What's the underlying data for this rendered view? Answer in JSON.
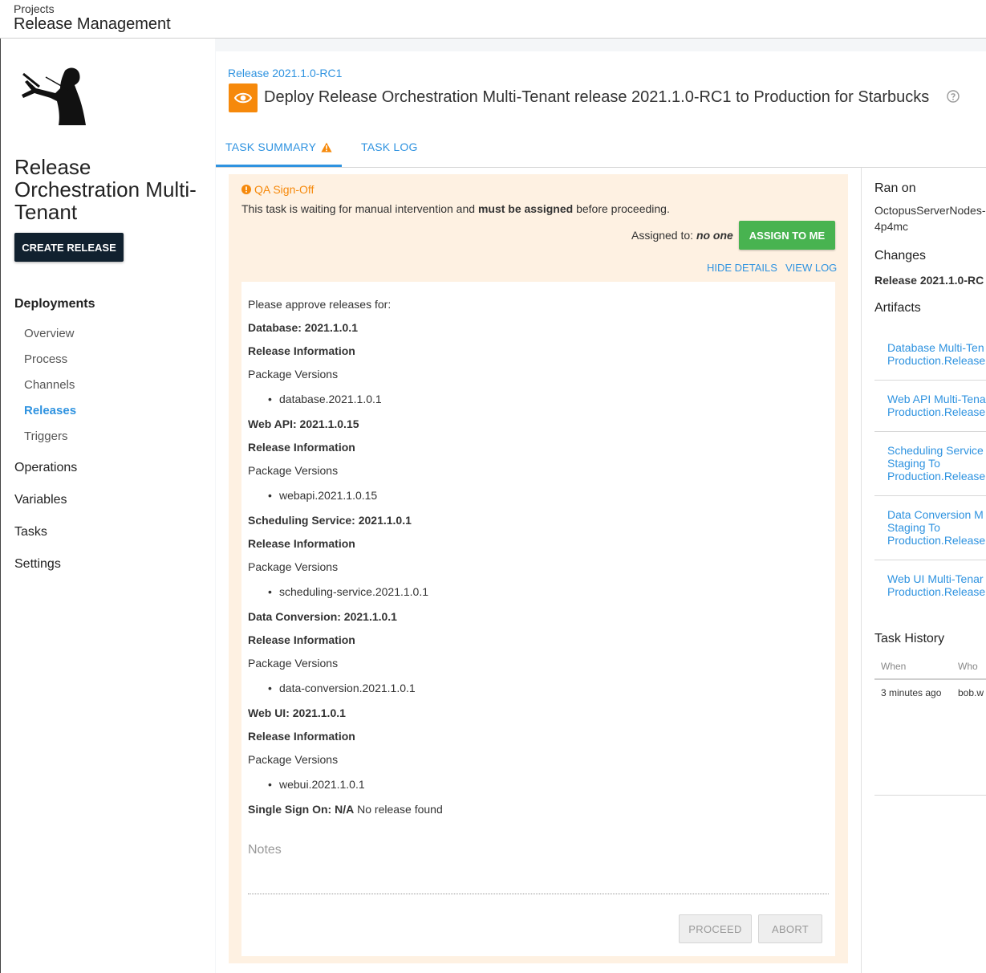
{
  "header": {
    "breadcrumb": "Projects",
    "title": "Release Management"
  },
  "sidebar": {
    "project_name": "Release Orchestration Multi-Tenant",
    "create_release_label": "CREATE RELEASE",
    "sections": {
      "deployments": "Deployments",
      "operations": "Operations",
      "variables": "Variables",
      "tasks": "Tasks",
      "settings": "Settings"
    },
    "deployment_items": [
      "Overview",
      "Process",
      "Channels",
      "Releases",
      "Triggers"
    ],
    "active_item": "Releases"
  },
  "task": {
    "release_link": "Release 2021.1.0-RC1",
    "title": "Deploy Release Orchestration Multi-Tenant release 2021.1.0-RC1 to Production for Starbucks",
    "tabs": [
      "TASK SUMMARY",
      "TASK LOG"
    ],
    "active_tab": "TASK SUMMARY"
  },
  "intervention": {
    "step_name": "QA Sign-Off",
    "desc_prefix": "This task is waiting for manual intervention and ",
    "desc_bold": "must be assigned",
    "desc_suffix": " before proceeding.",
    "assigned_label": "Assigned to: ",
    "assigned_value": "no one",
    "assign_button": "ASSIGN TO ME",
    "hide_details": "HIDE DETAILS",
    "view_log": "VIEW LOG",
    "intro": "Please approve releases for:",
    "releases": [
      {
        "heading": "Database: 2021.1.0.1",
        "info": "Release Information",
        "pkg_label": "Package Versions",
        "package": "database.2021.1.0.1"
      },
      {
        "heading": "Web API: 2021.1.0.15",
        "info": "Release Information",
        "pkg_label": "Package Versions",
        "package": "webapi.2021.1.0.15"
      },
      {
        "heading": "Scheduling Service: 2021.1.0.1",
        "info": "Release Information",
        "pkg_label": "Package Versions",
        "package": "scheduling-service.2021.1.0.1"
      },
      {
        "heading": "Data Conversion: 2021.1.0.1",
        "info": "Release Information",
        "pkg_label": "Package Versions",
        "package": "data-conversion.2021.1.0.1"
      },
      {
        "heading": "Web UI: 2021.1.0.1",
        "info": "Release Information",
        "pkg_label": "Package Versions",
        "package": "webui.2021.1.0.1"
      }
    ],
    "sso_label": "Single Sign On: N/A",
    "sso_value": " No release found",
    "notes_placeholder": "Notes",
    "proceed": "PROCEED",
    "abort": "ABORT"
  },
  "right": {
    "ran_on_label": "Ran on",
    "ran_on_line1": "OctopusServerNodes-",
    "ran_on_line2": "4p4mc",
    "changes_label": "Changes",
    "changes_value": "Release 2021.1.0-RC",
    "artifacts_label": "Artifacts",
    "artifacts": [
      [
        "Database Multi-Ten",
        "Production.Release"
      ],
      [
        "Web API Multi-Tena",
        "Production.Release"
      ],
      [
        "Scheduling Service",
        "Staging To",
        "Production.Release"
      ],
      [
        "Data Conversion M",
        "Staging To",
        "Production.Release"
      ],
      [
        "Web UI Multi-Tenar",
        "Production.Release"
      ]
    ],
    "history_label": "Task History",
    "history_cols": [
      "When",
      "Who"
    ],
    "history_rows": [
      [
        "3 minutes ago",
        "bob.w"
      ]
    ]
  },
  "colors": {
    "accent": "#2f93e0",
    "orange": "#f6890b",
    "green": "#48b350",
    "navy": "#11212f",
    "panel": "#fef1e2"
  }
}
